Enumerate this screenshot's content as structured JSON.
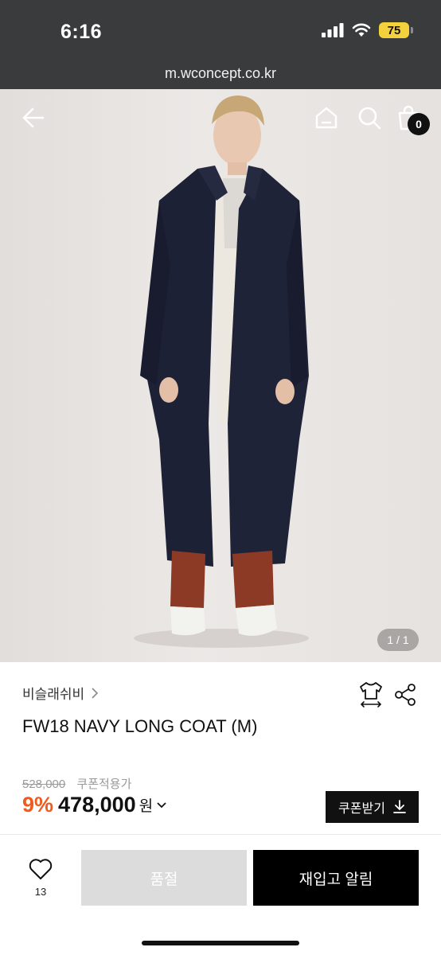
{
  "status_bar": {
    "time": "6:16",
    "battery": "75"
  },
  "browser": {
    "url": "m.wconcept.co.kr"
  },
  "gallery": {
    "pager": "1 / 1",
    "cart_count": "0"
  },
  "product": {
    "brand": "비슬래쉬비",
    "title": "FW18 NAVY LONG COAT (M)",
    "original_price": "528,000",
    "coupon_note": "쿠폰적용가",
    "discount": "9%",
    "price": "478,000",
    "currency": "원",
    "coupon_button": "쿠폰받기"
  },
  "bottom_bar": {
    "like_count": "13",
    "soldout_label": "품절",
    "restock_label": "재입고 알림"
  },
  "colors": {
    "accent": "#ef5a1e",
    "dark": "#111111",
    "topbar": "#3a3b3d"
  }
}
